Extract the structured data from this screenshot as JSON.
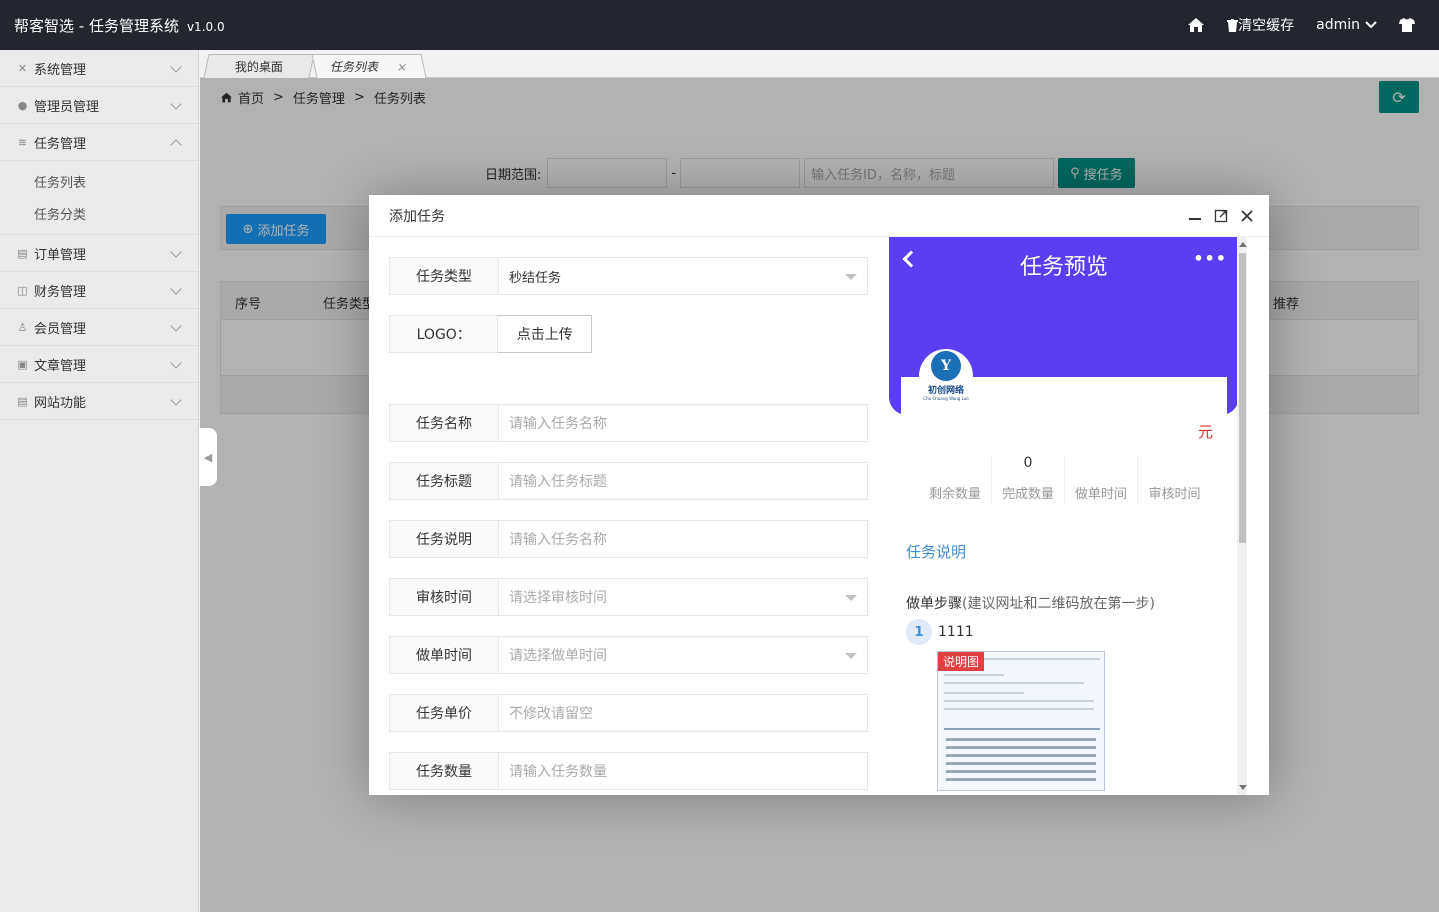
{
  "app": {
    "title": "帮客智选 - 任务管理系统",
    "version": "v1.0.0"
  },
  "header": {
    "clear_cache": "清空缓存",
    "user": "admin",
    "icons": [
      "home-icon",
      "trash-icon",
      "chevron-down-icon",
      "shirt-icon"
    ]
  },
  "sidebar": {
    "items": [
      {
        "label": "系统管理",
        "icon": "tools-icon",
        "open": false
      },
      {
        "label": "管理员管理",
        "icon": "user-icon",
        "open": false
      },
      {
        "label": "任务管理",
        "icon": "database-icon",
        "open": true,
        "children": [
          "任务列表",
          "任务分类"
        ]
      },
      {
        "label": "订单管理",
        "icon": "table-icon",
        "open": false
      },
      {
        "label": "财务管理",
        "icon": "book-icon",
        "open": false
      },
      {
        "label": "会员管理",
        "icon": "users-icon",
        "open": false
      },
      {
        "label": "文章管理",
        "icon": "article-icon",
        "open": false
      },
      {
        "label": "网站功能",
        "icon": "list-icon",
        "open": false
      }
    ]
  },
  "tabs": [
    {
      "label": "我的桌面"
    },
    {
      "label": "任务列表",
      "close": "×"
    }
  ],
  "breadcrumb": {
    "home": "首页",
    "sep": ">",
    "level1": "任务管理",
    "level2": "任务列表"
  },
  "search": {
    "date_label": "日期范围:",
    "dash": "-",
    "keyword_placeholder": "输入任务ID，名称，标题",
    "search_button": "搜任务"
  },
  "toolbar": {
    "add_button": "添加任务"
  },
  "table": {
    "headers": [
      "序号",
      "任务类型",
      "推荐"
    ]
  },
  "modal": {
    "title": "添加任务",
    "form": {
      "type_label": "任务类型",
      "type_value": "秒结任务",
      "logo_label": "LOGO：",
      "upload_button": "点击上传",
      "name_label": "任务名称",
      "name_placeholder": "请输入任务名称",
      "title_label": "任务标题",
      "title_placeholder": "请输入任务标题",
      "desc_label": "任务说明",
      "desc_placeholder": "请输入任务名称",
      "audit_label": "审核时间",
      "audit_placeholder": "请选择审核时间",
      "do_label": "做单时间",
      "do_placeholder": "请选择做单时间",
      "price_label": "任务单价",
      "price_placeholder": "不修改请留空",
      "qty_label": "任务数量",
      "qty_placeholder": "请输入任务数量"
    },
    "preview": {
      "title": "任务预览",
      "more": "•••",
      "logo_text": "初创网络",
      "logo_sub": "Chu Chuang Wang Luo",
      "price_unit": "元",
      "stats": [
        {
          "label": "剩余数量",
          "value": ""
        },
        {
          "label": "完成数量",
          "value": "0"
        },
        {
          "label": "做单时间",
          "value": ""
        },
        {
          "label": "审核时间",
          "value": ""
        }
      ],
      "desc_heading": "任务说明",
      "steps_heading": "做单步骤",
      "steps_hint": "(建议网址和二维码放在第一步)",
      "step_num": "1",
      "step_text": "1111",
      "image_tag": "说明图"
    }
  },
  "colors": {
    "header_bg": "#23262e",
    "green": "#009688",
    "blue": "#1e9fff",
    "preview_purple": "#5b3df2",
    "price_red": "#e03030"
  }
}
